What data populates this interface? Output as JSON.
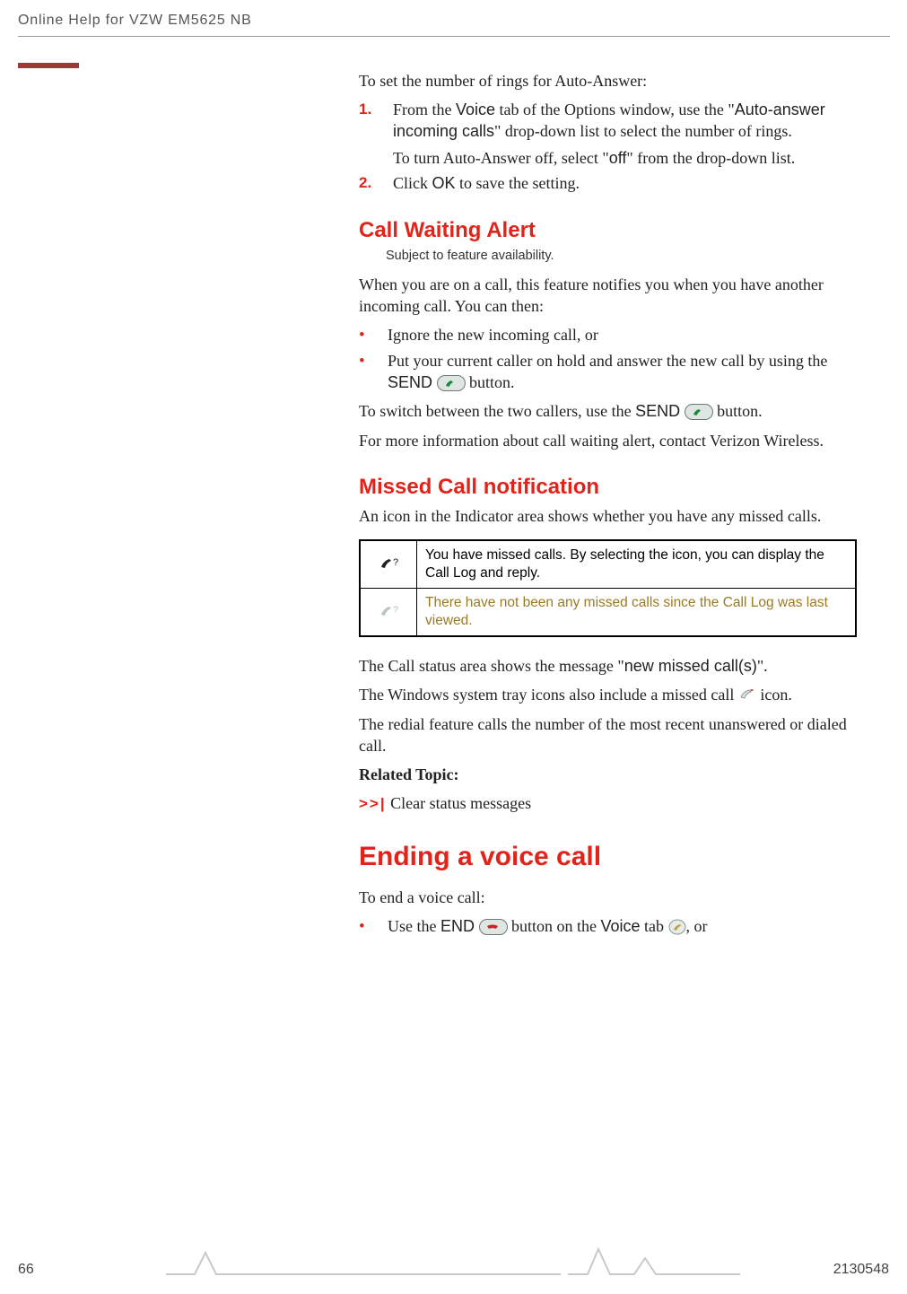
{
  "header": {
    "title": "Online Help for VZW EM5625 NB"
  },
  "intro": "To set the number of rings for Auto-Answer:",
  "steps": {
    "s1": {
      "num": "1.",
      "pre": "From the ",
      "voice": "Voice",
      "mid1": " tab of the Options window, use the \"",
      "auto": "Auto-answer incoming calls",
      "mid2": "\" drop-down list to select the number of rings.",
      "ind_a": "To turn Auto-Answer off, select \"",
      "off": "off",
      "ind_b": "\" from the drop-down list."
    },
    "s2": {
      "num": "2.",
      "a": "Click ",
      "ok": "OK",
      "b": " to save the setting."
    }
  },
  "cw": {
    "heading": "Call Waiting Alert",
    "sub": "Subject to feature availability.",
    "p1": "When you are on a call, this feature notifies you when you have another incoming call. You can then:",
    "b1": "Ignore the new incoming call, or",
    "b2a": "Put your current caller on hold and answer the new call by using the ",
    "send": "SEND",
    "b2b": "  button.",
    "p2a": "To switch between the two callers, use the ",
    "p2b": "  button.",
    "p3": "For more information about call waiting alert, contact Verizon Wireless."
  },
  "mc": {
    "heading": "Missed Call notification",
    "p1": "An icon in the Indicator area shows whether you have any missed calls.",
    "row1": "You have missed calls. By selecting the icon, you can display the Call Log and reply.",
    "row2": "There have not been any missed calls since the Call Log was last viewed.",
    "p2a": "The Call status area shows the message \"",
    "newmsg": "new missed call(s)",
    "p2b": "\".",
    "p3a": "The Windows system tray icons also include a missed call ",
    "p3b": " icon.",
    "p4": "The redial feature calls the number of the most recent unanswered or dialed call.",
    "related": "Related Topic:",
    "link_sym": ">>|",
    "link_txt": " Clear status messages"
  },
  "end": {
    "heading": "Ending a voice call",
    "p1": "To end a voice call:",
    "b1a": "Use the ",
    "end_lbl": "END",
    "b1b": "  button on the ",
    "voice": "Voice",
    "b1c": " tab ",
    "b1d": ", or"
  },
  "footer": {
    "page": "66",
    "doc": "2130548"
  }
}
